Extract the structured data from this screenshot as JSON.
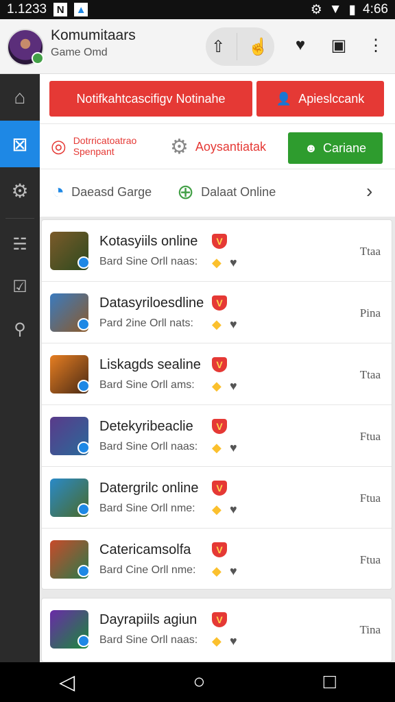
{
  "status": {
    "time_left": "1.1233",
    "badge_n": "N",
    "time_right": "4:66"
  },
  "header": {
    "title": "Komumitaars",
    "subtitle": "Game Omd"
  },
  "actions": {
    "notify_label": "Notifkahtcascifigv Notinahe",
    "apply_label": "Apieslccank",
    "promo_line1": "Dotrricatoatrao",
    "promo_line2": "Spenpant",
    "settings_label": "Aoysantiatak",
    "green_label": "Cariane",
    "chat_label": "Daeasd Garge",
    "online_label": "Dalaat Online"
  },
  "games": [
    {
      "title": "Kotasyiils online",
      "subtitle": "Bard Sine Orll naas:",
      "right": "Ttaa",
      "colors": [
        "#7b5a2a",
        "#2d4a1e"
      ]
    },
    {
      "title": "Datasyriloesdline",
      "subtitle": "Pard 2ine Orll nats:",
      "right": "Pina",
      "colors": [
        "#3a7bbf",
        "#8b5a2b"
      ]
    },
    {
      "title": "Liskagds sealine",
      "subtitle": "Bard Sine Orll ams:",
      "right": "Ttaa",
      "colors": [
        "#e67e22",
        "#4a2a14"
      ]
    },
    {
      "title": "Detekyribeaclie",
      "subtitle": "Bard Sine Orll naas:",
      "right": "Ftua",
      "colors": [
        "#5a3a8a",
        "#2a6a9a"
      ]
    },
    {
      "title": "Datergrilc online",
      "subtitle": "Bard Sine Orll nme:",
      "right": "Ftua",
      "colors": [
        "#2a8ac8",
        "#4a6a2a"
      ]
    },
    {
      "title": "Catericamsolfa",
      "subtitle": "Bard Cine Orll nme:",
      "right": "Ftua",
      "colors": [
        "#c84a2a",
        "#2a7a4a"
      ]
    }
  ],
  "games_extra": [
    {
      "title": "Dayrapiils agiun",
      "subtitle": "Bard Sine Orll naas:",
      "right": "Tina",
      "colors": [
        "#6a2aa8",
        "#1a8a3a"
      ]
    }
  ],
  "badge_letter": "V"
}
